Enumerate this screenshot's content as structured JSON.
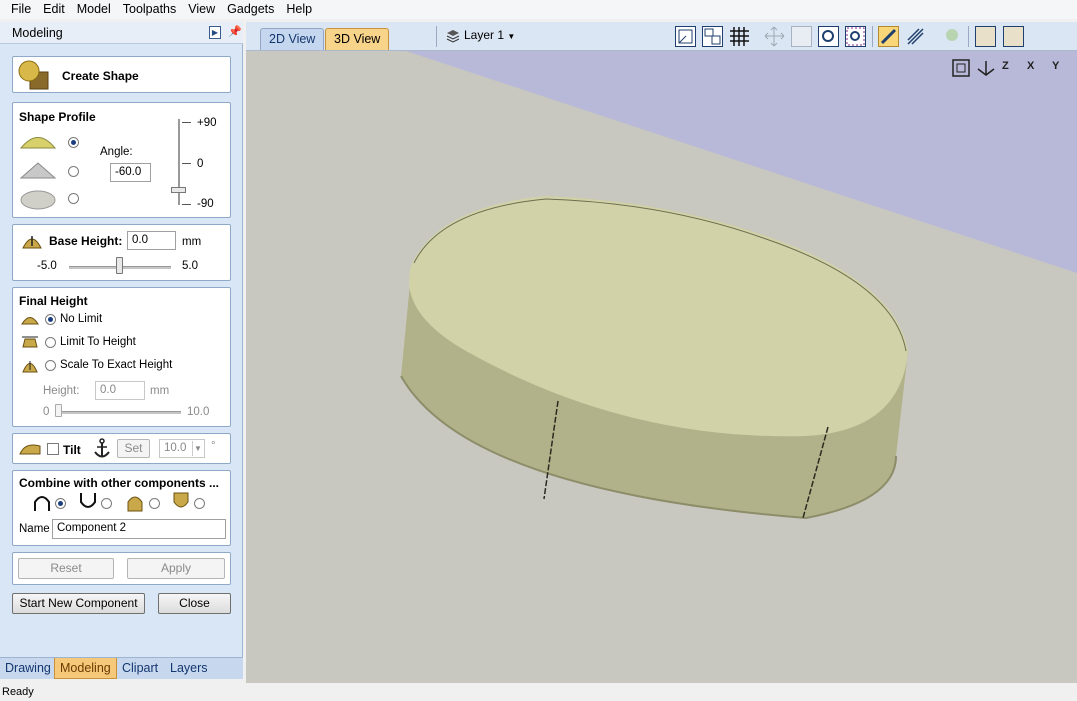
{
  "menu": [
    "File",
    "Edit",
    "Model",
    "Toolpaths",
    "View",
    "Gadgets",
    "Help"
  ],
  "panel": {
    "title": "Modeling",
    "create_shape": "Create Shape",
    "shape_profile": {
      "title": "Shape Profile",
      "angle_label": "Angle:",
      "angle_value": "-60.0",
      "scale_top": "+90",
      "scale_mid": "0",
      "scale_bottom": "-90",
      "selected_profile": "round",
      "angle_fraction": 0.17
    },
    "base_height": {
      "label": "Base Height:",
      "value": "0.0",
      "unit": "mm",
      "min": "-5.0",
      "max": "5.0"
    },
    "final_height": {
      "title": "Final Height",
      "options": [
        "No Limit",
        "Limit To Height",
        "Scale To Exact Height"
      ],
      "selected": "No Limit",
      "height_label": "Height:",
      "height_value": "0.0",
      "height_unit": "mm",
      "min": "0",
      "max": "10.0"
    },
    "tilt": {
      "label": "Tilt",
      "set_label": "Set",
      "value": "10.0",
      "degree": "°"
    },
    "combine": {
      "title": "Combine with other components ...",
      "name_label": "Name",
      "name_value": "Component 2"
    },
    "reset_label": "Reset",
    "apply_label": "Apply",
    "start_new_label": "Start New Component",
    "close_label": "Close"
  },
  "bottom_tabs": [
    "Drawing",
    "Modeling",
    "Clipart",
    "Layers"
  ],
  "active_bottom_tab": "Modeling",
  "view_tabs": [
    "2D View",
    "3D View"
  ],
  "active_view_tab": "3D View",
  "layer": "Layer 1",
  "axis_buttons": [
    "Z",
    "X",
    "Y"
  ],
  "status": "Ready",
  "colors": {
    "accent": "#f8d38a",
    "panel": "#d9e6f5",
    "viewport_bg": "#b9bad4",
    "plane": "#c8c8c0",
    "model": "#c4c49a"
  }
}
